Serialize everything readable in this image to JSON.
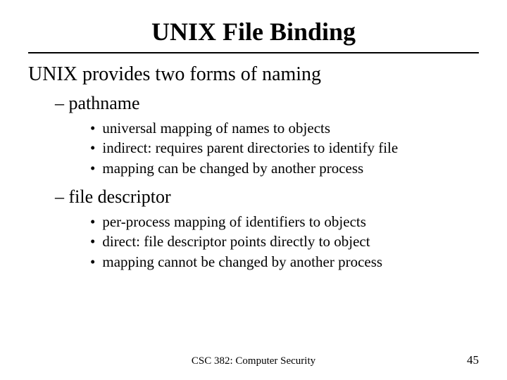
{
  "title": "UNIX File Binding",
  "intro": "UNIX provides two forms of naming",
  "sections": [
    {
      "label": "– pathname",
      "bullets": [
        "universal mapping of names to objects",
        "indirect: requires parent directories to identify file",
        "mapping can be changed by another process"
      ]
    },
    {
      "label": "– file descriptor",
      "bullets": [
        "per-process mapping of identifiers to objects",
        "direct: file descriptor points directly to object",
        "mapping cannot be changed by another process"
      ]
    }
  ],
  "footer": "CSC 382: Computer Security",
  "page": "45"
}
